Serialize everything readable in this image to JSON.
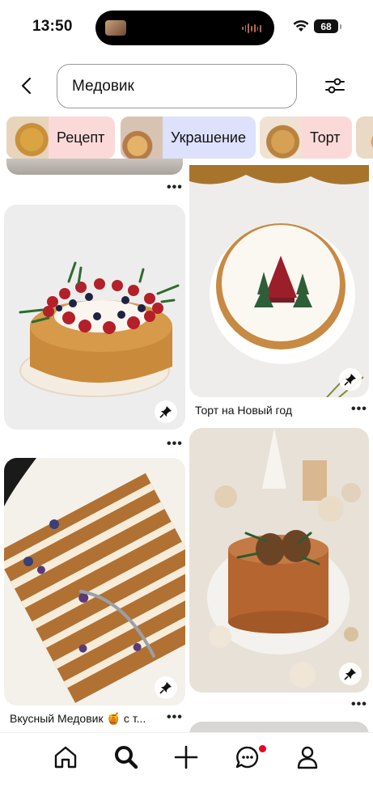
{
  "status_bar": {
    "time": "13:50",
    "battery": "68"
  },
  "search": {
    "query": "Медовик"
  },
  "chips": [
    {
      "label": "Рецепт",
      "bg": "#fcd9d9"
    },
    {
      "label": "Украшение",
      "bg": "#dde1fb"
    },
    {
      "label": "Торт",
      "bg": "#fcd9d9"
    }
  ],
  "pins": [
    {
      "caption": ""
    },
    {
      "caption": "Торт на Новый год"
    },
    {
      "caption": "Вкусный Медовик 🍯 с т..."
    },
    {
      "caption": ""
    }
  ],
  "more_label": "•••",
  "colors": {
    "accent": "#e60023",
    "chip_pink": "#fcd9d9",
    "chip_blue": "#dde1fb"
  },
  "tab_bar": [
    "home-icon",
    "search-icon",
    "plus-icon",
    "messages-icon",
    "profile-icon"
  ]
}
